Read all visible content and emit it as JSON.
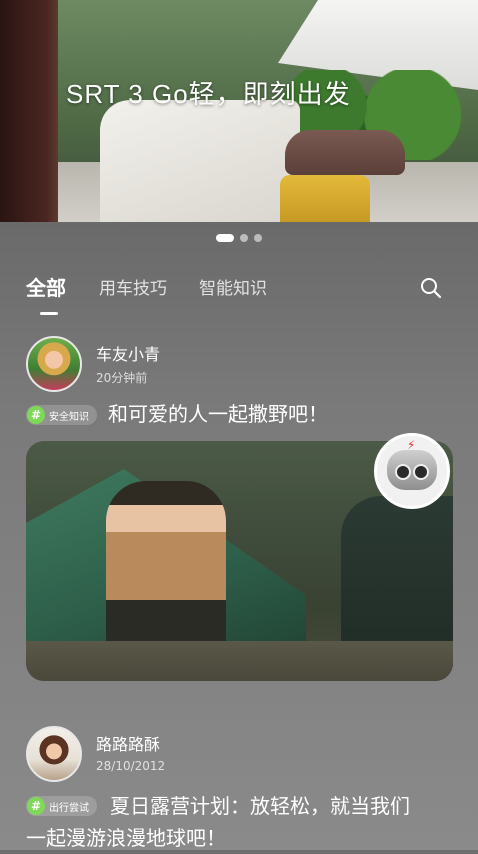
{
  "banner": {
    "title": "SRT 3   Go轻，即刻出发",
    "pager": {
      "count": 3,
      "active_index": 0
    }
  },
  "tabs": {
    "items": [
      {
        "label": "全部",
        "active": true
      },
      {
        "label": "用车技巧",
        "active": false
      },
      {
        "label": "智能知识",
        "active": false
      }
    ]
  },
  "icons": {
    "search": "search-icon",
    "tag": "hash-icon"
  },
  "colors": {
    "tag_accent": "#7ed957",
    "feed_bg": "#7a7a7a"
  },
  "posts": [
    {
      "username": "车友小青",
      "timestamp": "20分钟前",
      "tag": "安全知识",
      "text": "和可爱的人一起撒野吧！"
    },
    {
      "username": "路路路酥",
      "timestamp": "28/10/2012",
      "tag": "出行尝试",
      "text_line1": "夏日露营计划：放轻松，就当我们",
      "text_line2": "一起漫游浪漫地球吧！"
    }
  ]
}
